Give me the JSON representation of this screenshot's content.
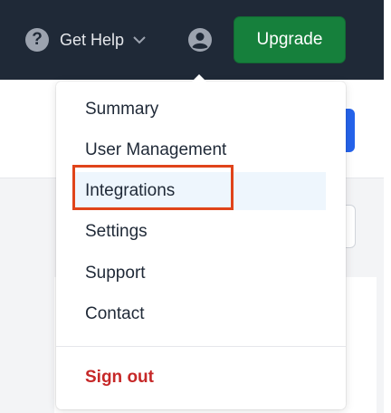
{
  "header": {
    "get_help_label": "Get Help",
    "help_icon_glyph": "?",
    "upgrade_label": "Upgrade"
  },
  "menu": {
    "items": [
      {
        "label": "Summary"
      },
      {
        "label": "User Management"
      },
      {
        "label": "Integrations",
        "highlighted": true
      },
      {
        "label": "Settings"
      },
      {
        "label": "Support"
      },
      {
        "label": "Contact"
      }
    ],
    "sign_out_label": "Sign out"
  },
  "icons": [
    "question-circle-icon",
    "chevron-down-icon",
    "user-circle-icon"
  ],
  "colors": {
    "topbar": "#1f2937",
    "upgrade": "#16803c",
    "sign_out": "#c62828",
    "highlight_box": "#e0441a",
    "active_item_bg": "#eef6fd"
  }
}
